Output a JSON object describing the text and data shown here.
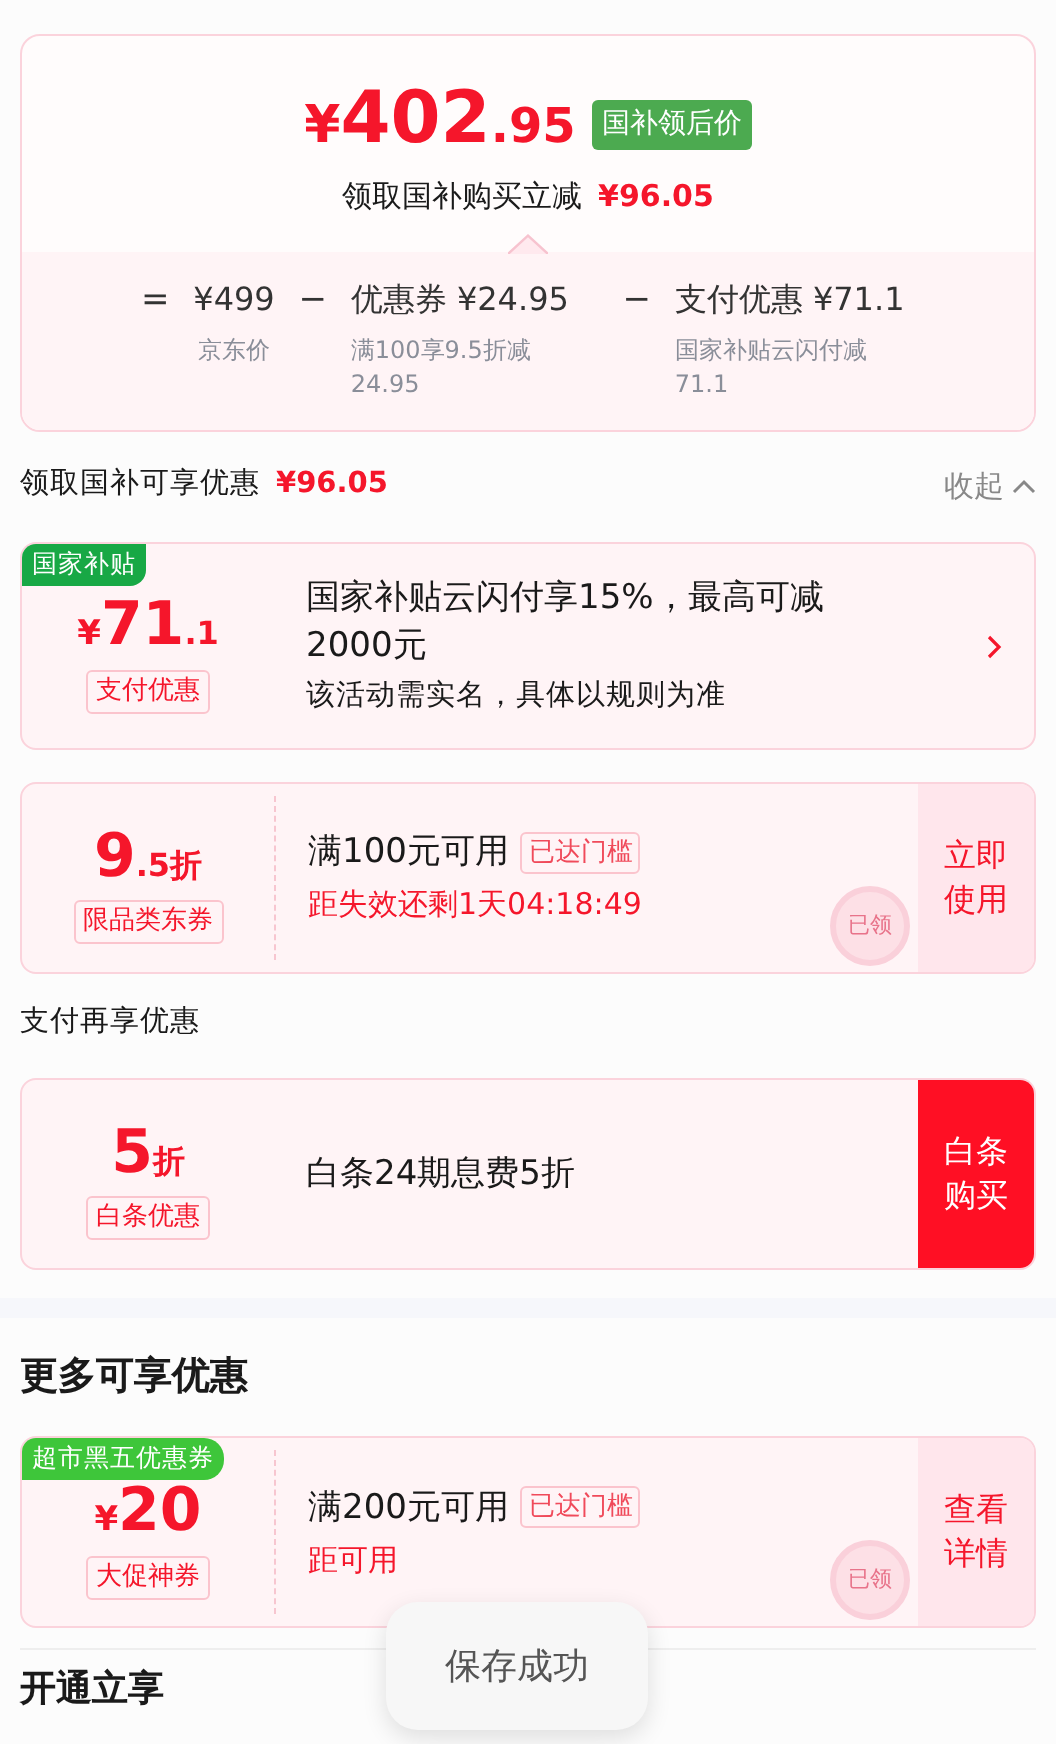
{
  "price_summary": {
    "currency": "¥",
    "price_integer": "402",
    "price_decimal": ".95",
    "badge": "国补领后价",
    "saving_label": "领取国补购买立减",
    "saving_amount": "¥96.05",
    "formula": [
      {
        "op": "=",
        "amount": "¥499",
        "note": "京东价"
      },
      {
        "op": "−",
        "amount": "优惠券 ¥24.95",
        "note": "满100享9.5折减 24.95"
      },
      {
        "op": "−",
        "amount": "支付优惠 ¥71.1",
        "note": "国家补贴云闪付减 71.1"
      }
    ]
  },
  "subsidy_header": {
    "title": "领取国补可享优惠",
    "amount": "¥96.05",
    "toggle": "收起",
    "expanded": true
  },
  "subsidy_offers": [
    {
      "kind": "subsidy",
      "tag": "国家补贴",
      "currency": "¥",
      "value": "71",
      "decimal": ".1",
      "label": "支付优惠",
      "title": "国家补贴云闪付享15%，最高可减2000元",
      "desc": "该活动需实名，具体以规则为准"
    },
    {
      "kind": "coupon",
      "value": "9",
      "decimal": ".5折",
      "label": "限品类东券",
      "title": "满100元可用",
      "status": "已达门槛",
      "countdown": "距失效还剩1天04:18:49",
      "action": "立即使用",
      "stamp": "已领"
    }
  ],
  "payment_header": {
    "title": "支付再享优惠"
  },
  "payment_offers": [
    {
      "kind": "payment",
      "value": "5",
      "decimal": "折",
      "label": "白条优惠",
      "title": "白条24期息费5折",
      "action": "白条购买"
    }
  ],
  "more_section": {
    "title": "更多可享优惠",
    "offers": [
      {
        "kind": "coupon",
        "tag": "超市黑五优惠券",
        "currency": "¥",
        "value": "20",
        "label": "大促神券",
        "title": "满200元可用",
        "status": "已达门槛",
        "countdown": "距可用",
        "action": "查看详情",
        "stamp": "已领"
      }
    ]
  },
  "next_section": {
    "title": "开通立享"
  },
  "toast": {
    "text": "保存成功"
  }
}
